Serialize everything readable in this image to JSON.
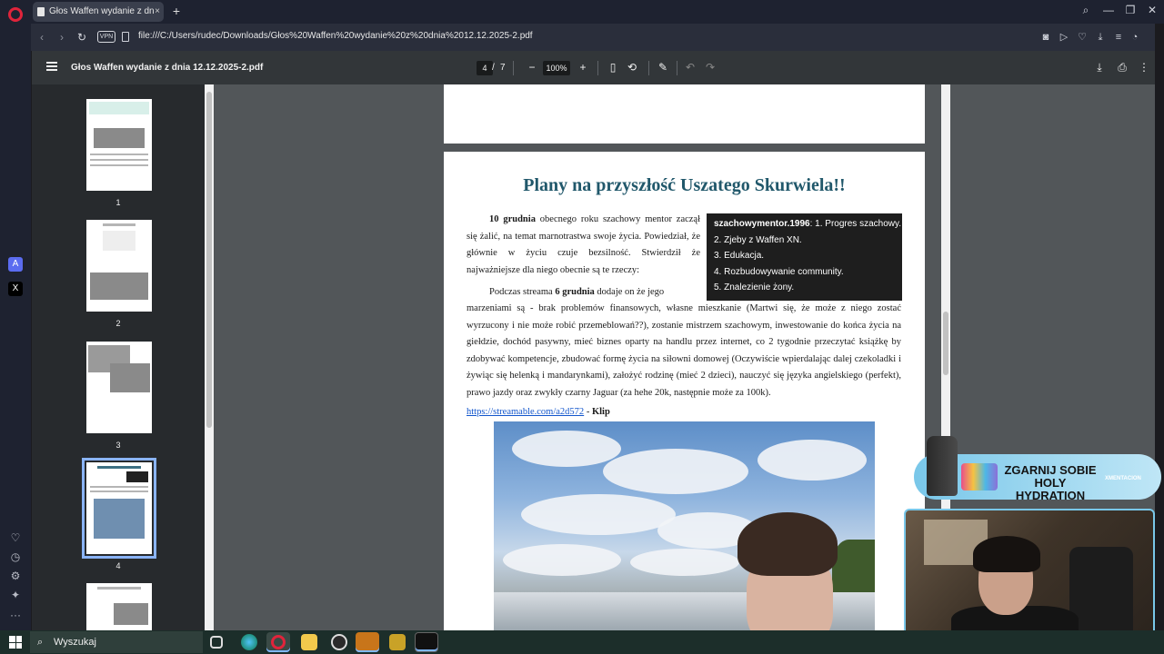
{
  "browser": {
    "tab_title": "Głos Waffen wydanie z dn",
    "new_tab": "+",
    "tab_close": "×",
    "vpn_label": "VPN",
    "url": "file:///C:/Users/rudec/Downloads/Głos%20Waffen%20wydanie%20z%20dnia%2012.12.2025-2.pdf"
  },
  "pdf_toolbar": {
    "file_title": "Głos Waffen wydanie z dnia 12.12.2025-2.pdf",
    "current_page": "4",
    "page_separator": "/",
    "total_pages": "7",
    "zoom": "100%"
  },
  "thumbnails": [
    {
      "num": "1"
    },
    {
      "num": "2"
    },
    {
      "num": "3"
    },
    {
      "num": "4",
      "selected": true
    }
  ],
  "page": {
    "title": "Plany na przyszłość Uszatego Skurwiela!!",
    "p1_bold": "10 grudnia",
    "p1_rest": " obecnego roku szachowy mentor zaczął się żalić, na temat marnotrastwa swoje życia. Powiedział, że głównie w życiu czuje bezsilność. Stwierdził że najważniejsze dla niego obecnie są te rzeczy:",
    "p2_start": "Podczas streama ",
    "p2_bold": "6 grudnia",
    "p2_rest": " dodaje on że jego",
    "p3": "marzeniami są - brak problemów finansowych, własne mieszkanie (Martwi się, że może z niego zostać wyrzucony i nie może robić przemeblowań??), zostanie mistrzem szachowym, inwestowanie do końca życia na giełdzie, dochód pasywny, mieć biznes oparty na handlu przez internet, co 2 tygodnie przeczytać książkę by zdobywać kompetencje, zbudować formę życia na siłowni domowej (Oczywiście wpierdalając dalej czekoladki i żywiąc się helenką i mandarynkami), założyć rodzinę (mieć 2 dzieci), nauczyć się języka angielskiego (perfekt), prawo jazdy oraz zwykły czarny Jaguar (za hehe 20k, następnie może za 100k).",
    "box_user": "szachowymentor.1996",
    "box_items": [
      ": 1. Progres szachowy.",
      "2. Zjeby z Waffen XN.",
      "3. Edukacja.",
      "4. Rozbudowywanie community.",
      "5. Znalezienie żony."
    ],
    "link": "https://streamable.com/a2d572",
    "link_suffix_sep": " - ",
    "link_suffix": "Klip"
  },
  "overlay": {
    "banner_line1": "ZGARNIJ SOBIE",
    "banner_line2": "HOLY HYDRATION",
    "banner_brand": "XMENTACION"
  },
  "taskbar": {
    "search_placeholder": "Wyszukaj"
  }
}
